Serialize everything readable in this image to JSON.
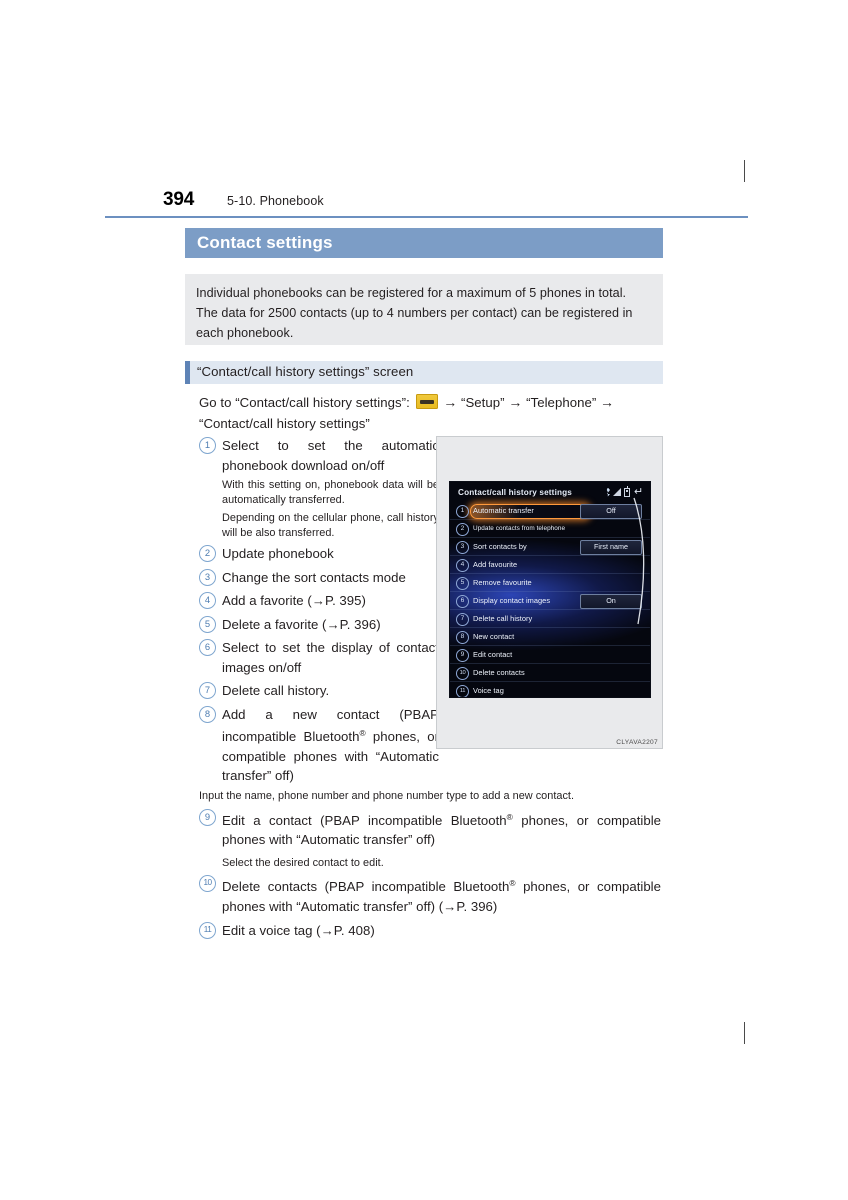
{
  "page": {
    "number": "394",
    "chapter": "5-10. Phonebook",
    "figure_caption": "CLYAVA2207"
  },
  "section": {
    "title": "Contact settings",
    "notice": "Individual phonebooks can be registered for a maximum of 5 phones in total. The data for 2500 contacts (up to 4 numbers per contact) can be registered in each phonebook.",
    "subhead": "“Contact/call history settings” screen",
    "path_prefix": "Go to “Contact/call history settings”:",
    "path_icon": "menu-button-icon",
    "path_step1": "“Setup”",
    "path_step2": "“Telephone”",
    "path_step3": "“Contact/call history settings”"
  },
  "items": [
    {
      "num": "1",
      "text": "Select to set the automatic phonebook download on/off",
      "notes": [
        "With this setting on, phonebook data will be automatically transferred.",
        "Depending on the cellular phone, call history will be also transferred."
      ]
    },
    {
      "num": "2",
      "text": "Update phonebook",
      "notes": []
    },
    {
      "num": "3",
      "text": "Change the sort contacts mode",
      "notes": []
    },
    {
      "num": "4",
      "text": "Add a favorite (→P. 395)",
      "notes": []
    },
    {
      "num": "5",
      "text": "Delete a favorite (→P. 396)",
      "notes": []
    },
    {
      "num": "6",
      "text": "Select to set the display of contact images on/off",
      "notes": []
    },
    {
      "num": "7",
      "text": "Delete call history.",
      "notes": []
    },
    {
      "num": "8",
      "text_a": "Add a new contact (PBAP incompatible Bluetooth",
      "text_b": " phones, or compatible phones with “Automatic transfer” off)",
      "notes": [
        "Input the name, phone number and phone number type to add a new contact."
      ]
    },
    {
      "num": "9",
      "text_a": "Edit a contact (PBAP incompatible Bluetooth",
      "text_b": " phones, or compatible phones with “Automatic transfer” off)",
      "notes": [
        "Select the desired contact to edit."
      ]
    },
    {
      "num": "10",
      "text_a": "Delete contacts (PBAP incompatible Bluetooth",
      "text_b": " phones, or compatible phones with “Automatic transfer” off) (→P. 396)",
      "notes": []
    },
    {
      "num": "11",
      "text": "Edit a voice tag (→P. 408)",
      "notes": []
    }
  ],
  "screen": {
    "title": "Contact/call history settings",
    "status_icons": [
      "bluetooth-icon",
      "signal-icon",
      "battery-icon",
      "return-icon"
    ],
    "rows": [
      {
        "num": "1",
        "label": "Automatic transfer",
        "value": "Off",
        "selected": true,
        "small": false
      },
      {
        "num": "2",
        "label": "Update contacts from telephone",
        "value": "",
        "selected": false,
        "small": true
      },
      {
        "num": "3",
        "label": "Sort contacts by",
        "value": "First name",
        "selected": false,
        "small": false
      },
      {
        "num": "4",
        "label": "Add favourite",
        "value": "",
        "selected": false,
        "small": false
      },
      {
        "num": "5",
        "label": "Remove favourite",
        "value": "",
        "selected": false,
        "small": false
      },
      {
        "num": "6",
        "label": "Display contact images",
        "value": "On",
        "selected": false,
        "small": false
      },
      {
        "num": "7",
        "label": "Delete call history",
        "value": "",
        "selected": false,
        "small": false
      },
      {
        "num": "8",
        "label": "New contact",
        "value": "",
        "selected": false,
        "small": false
      },
      {
        "num": "9",
        "label": "Edit contact",
        "value": "",
        "selected": false,
        "small": false
      },
      {
        "num": "10",
        "label": "Delete contacts",
        "value": "",
        "selected": false,
        "small": false
      },
      {
        "num": "11",
        "label": "Voice tag",
        "value": "",
        "selected": false,
        "small": false
      }
    ]
  },
  "colors": {
    "accent_blue": "#7c9dc6",
    "rule_blue": "#6c90c0",
    "notice_gray": "#e9eaec",
    "subhead_blue": "#dfe7f1",
    "number_blue": "#4d7cb0",
    "highlight_orange": "#ff9a3c"
  }
}
